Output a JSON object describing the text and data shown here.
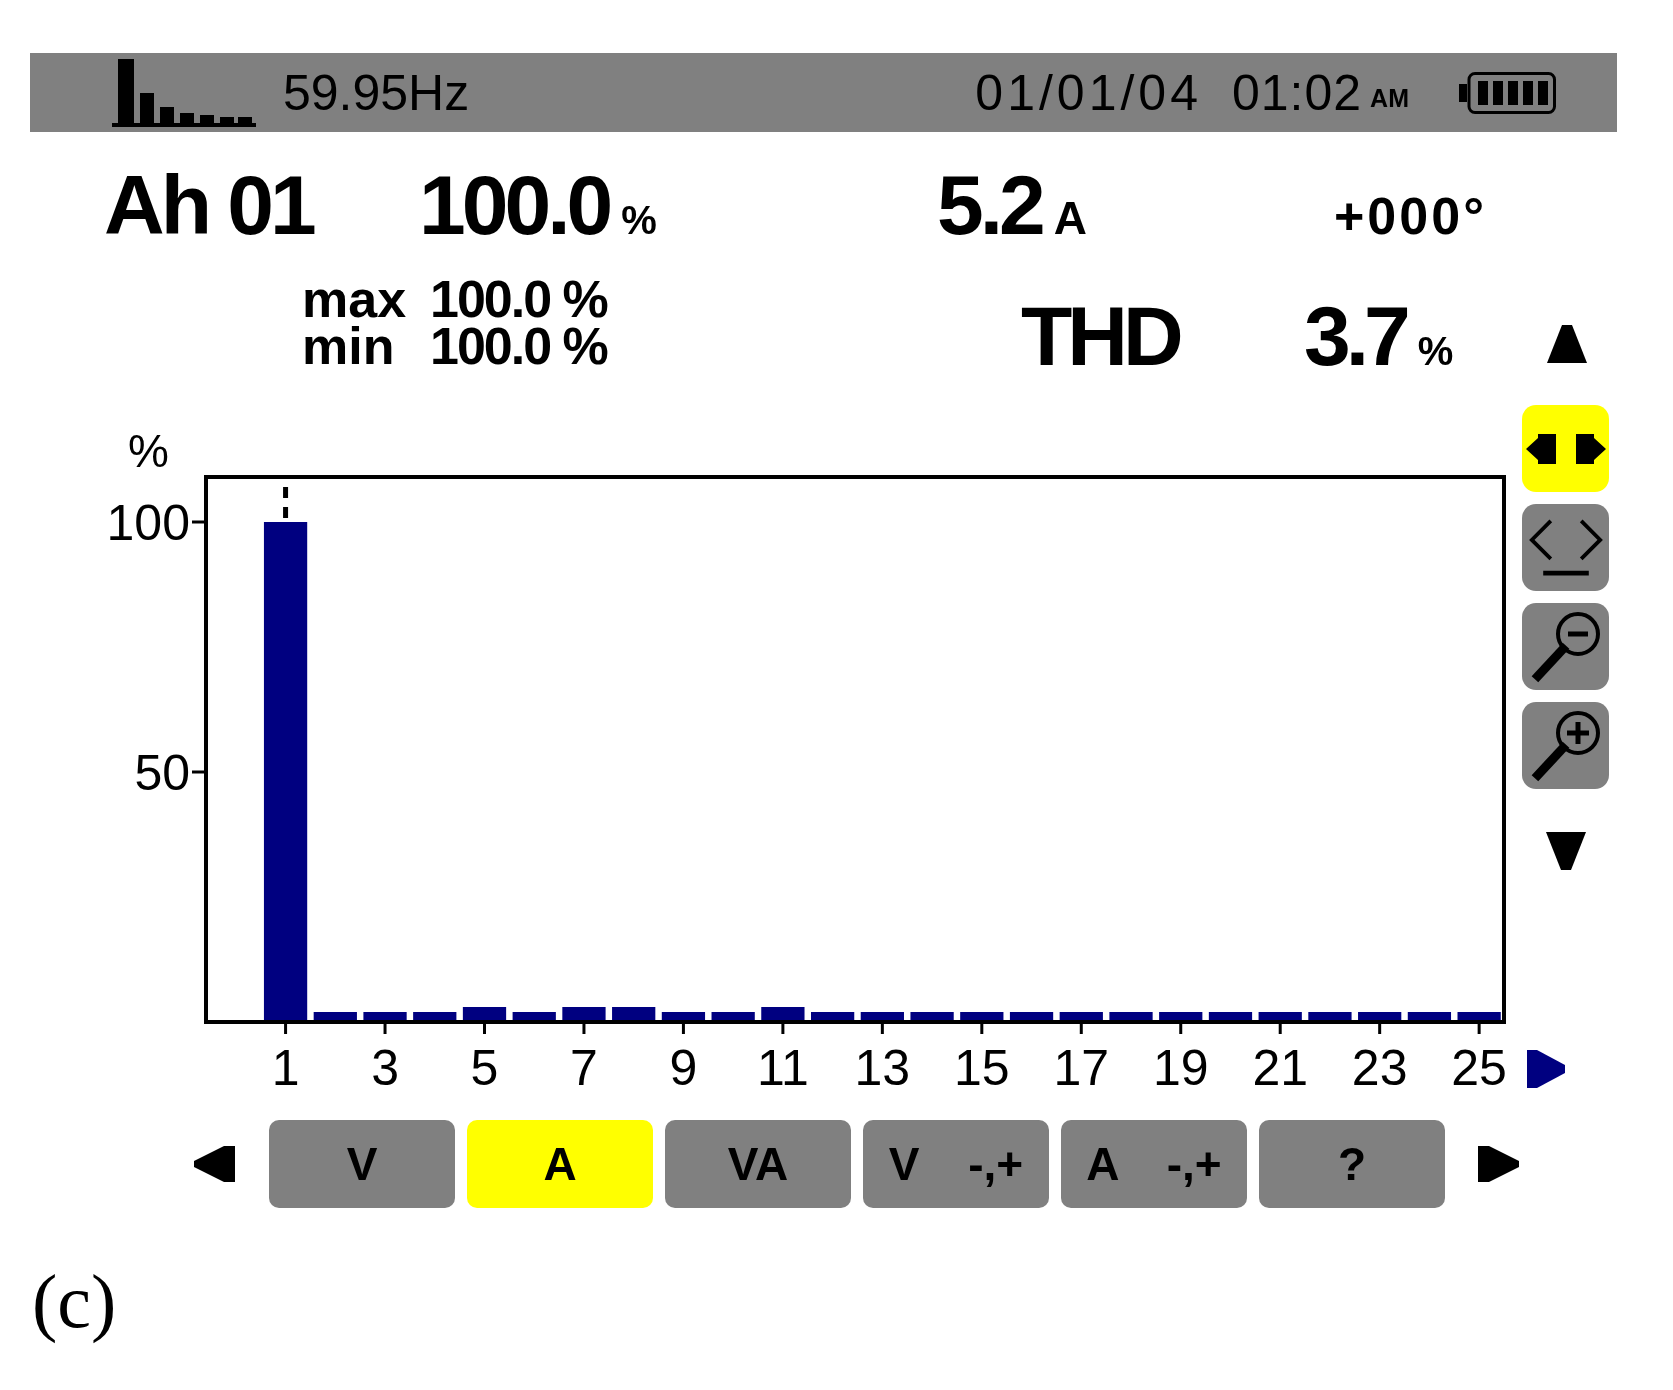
{
  "status_bar": {
    "frequency": "59.95Hz",
    "date": "01/01/04",
    "time": "01:02",
    "meridiem": "AM"
  },
  "readings": {
    "harmonic": "Ah 01",
    "percent": {
      "value": "100.0",
      "unit": "%"
    },
    "current": {
      "value": "5.2",
      "unit": "A"
    },
    "phase": "+000°",
    "max": {
      "label": "max",
      "value": "100.0 %"
    },
    "min": {
      "label": "min",
      "value": "100.0 %"
    },
    "thd": {
      "label": "THD",
      "value": "3.7",
      "unit": "%"
    }
  },
  "chart": {
    "chart_data": {
      "type": "bar",
      "ylabel": "%",
      "x": [
        1,
        2,
        3,
        4,
        5,
        6,
        7,
        8,
        9,
        10,
        11,
        12,
        13,
        14,
        15,
        16,
        17,
        18,
        19,
        20,
        21,
        22,
        23,
        24,
        25
      ],
      "values": [
        100,
        2,
        2,
        2,
        3,
        2,
        3,
        3,
        2,
        2,
        3,
        2,
        2,
        2,
        2,
        2,
        2,
        2,
        2,
        2,
        2,
        2,
        2,
        2,
        2
      ],
      "xlim": [
        -0.6,
        25.5
      ],
      "ylim": [
        0,
        109
      ],
      "xticks": [
        1,
        3,
        5,
        7,
        9,
        11,
        13,
        15,
        17,
        19,
        21,
        23,
        25
      ],
      "yticks": [
        50,
        100
      ]
    }
  },
  "side_tools": [
    {
      "kind": "cursor",
      "selected": true
    },
    {
      "kind": "zoom-reset",
      "selected": false
    },
    {
      "kind": "zoom-out",
      "selected": false
    },
    {
      "kind": "zoom-in",
      "selected": false
    }
  ],
  "tabs": [
    {
      "label": "V",
      "selected": false
    },
    {
      "label": "A",
      "selected": true
    },
    {
      "label": "VA",
      "selected": false
    },
    {
      "label": "V -,+",
      "selected": false
    },
    {
      "label": "A -,+",
      "selected": false
    },
    {
      "label": "?",
      "selected": false
    }
  ],
  "caption": "(c)"
}
